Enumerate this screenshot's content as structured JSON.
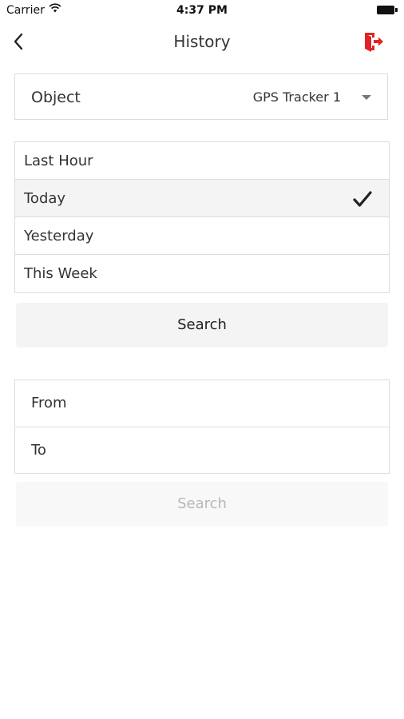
{
  "status_bar": {
    "carrier": "Carrier",
    "time": "4:37 PM"
  },
  "nav": {
    "title": "History",
    "accent_color": "#e02424"
  },
  "object_selector": {
    "label": "Object",
    "value": "GPS Tracker 1"
  },
  "periods": {
    "items": [
      "Last Hour",
      "Today",
      "Yesterday",
      "This Week"
    ],
    "selected": "Today"
  },
  "search_label": "Search",
  "range": {
    "from_label": "From",
    "to_label": "To"
  },
  "search_disabled_label": "Search"
}
